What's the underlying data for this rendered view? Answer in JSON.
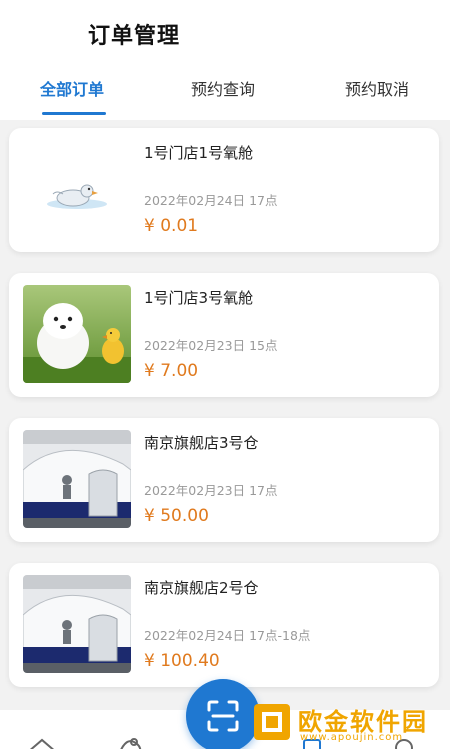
{
  "header": {
    "title": "订单管理"
  },
  "tabs": [
    {
      "label": "全部订单",
      "active": true
    },
    {
      "label": "预约查询",
      "active": false
    },
    {
      "label": "预约取消",
      "active": false
    }
  ],
  "orders": [
    {
      "name": "1号门店1号氧舱",
      "date": "2022年02月24日 17点",
      "price": "¥ 0.01",
      "thumbnail": "toy-duck-image"
    },
    {
      "name": "1号门店3号氧舱",
      "date": "2022年02月23日 15点",
      "price": "¥ 7.00",
      "thumbnail": "puppy-duckling-image"
    },
    {
      "name": "南京旗舰店3号仓",
      "date": "2022年02月23日 17点",
      "price": "¥ 50.00",
      "thumbnail": "oxygen-capsule-image"
    },
    {
      "name": "南京旗舰店2号仓",
      "date": "2022年02月24日 17点-18点",
      "price": "¥ 100.40",
      "thumbnail": "oxygen-capsule-image"
    }
  ],
  "fab": {
    "icon": "scan-icon"
  },
  "bottom_nav": [
    {
      "icon": "home-icon"
    },
    {
      "icon": "link-icon"
    },
    {
      "icon": "order-icon"
    },
    {
      "icon": "user-icon"
    }
  ],
  "watermark": {
    "main": "欧金软件园",
    "sub": "www.apoujin.com"
  },
  "colors": {
    "accent": "#1f78d1",
    "price": "#e07a1e",
    "watermark": "#f0a500"
  }
}
